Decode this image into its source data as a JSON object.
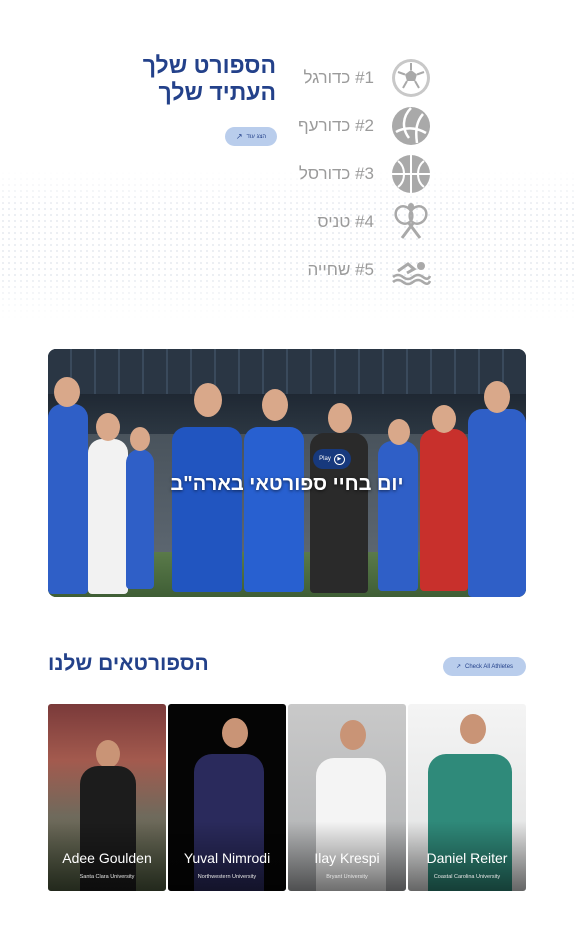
{
  "hero": {
    "title_line1": "הספורט שלך",
    "title_line2": "העתיד שלך",
    "learn_more_label": "הצג עוד"
  },
  "sports": [
    {
      "label": "#1 כדורגל",
      "icon": "soccer-ball-icon"
    },
    {
      "label": "#2 כדורעף",
      "icon": "volleyball-icon"
    },
    {
      "label": "#3 כדורסל",
      "icon": "basketball-icon"
    },
    {
      "label": "#4 טניס",
      "icon": "tennis-rackets-icon"
    },
    {
      "label": "#5 שחייה",
      "icon": "swimmer-icon"
    }
  ],
  "video": {
    "caption": "יום בחיי ספורטאי בארה\"ב",
    "play_label": "Play"
  },
  "athletes": {
    "title": "הספורטאים שלנו",
    "check_all_label": "Check All Athletes",
    "cards": [
      {
        "name": "Adee Goulden",
        "university": "Santa Clara University"
      },
      {
        "name": "Yuval Nimrodi",
        "university": "Northwestern University"
      },
      {
        "name": "Ilay Krespi",
        "university": "Bryant University"
      },
      {
        "name": "Daniel Reiter",
        "university": "Coastal Carolina University"
      }
    ]
  },
  "colors": {
    "brand_blue": "#23418a",
    "button_bg": "#b9cdec",
    "sport_gray": "#9b9b9b"
  }
}
